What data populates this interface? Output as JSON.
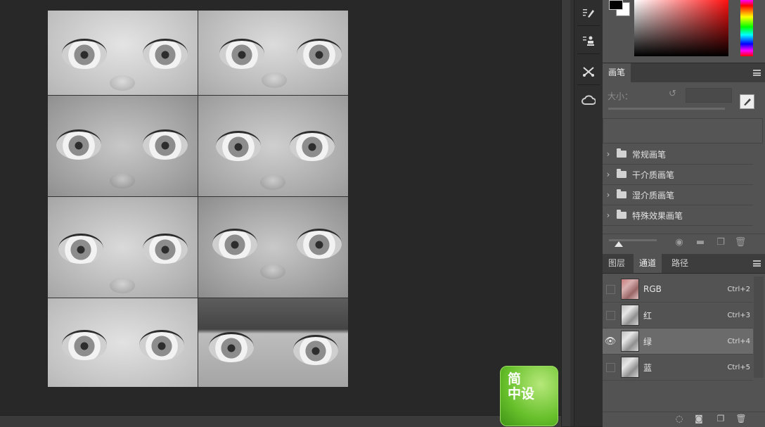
{
  "toolstrip": {
    "items": [
      {
        "icon": "brush-preset-icon"
      },
      {
        "icon": "clone-source-icon"
      },
      {
        "icon": "tool-presets-icon"
      },
      {
        "icon": "creative-cloud-icon"
      }
    ]
  },
  "color_panel": {
    "foreground": "#000000",
    "background": "#ffffff",
    "picker_hue": "#ff0000"
  },
  "brush_panel": {
    "tab": "画笔",
    "size_label": "大小：",
    "size_value": "",
    "folders": [
      "常规画笔",
      "干介质画笔",
      "湿介质画笔",
      "特殊效果画笔"
    ]
  },
  "channels_panel": {
    "tabs": [
      "图层",
      "通道",
      "路径"
    ],
    "active_tab": "通道",
    "channels": [
      {
        "name": "RGB",
        "shortcut": "Ctrl+2",
        "visible": false,
        "selected": false
      },
      {
        "name": "红",
        "shortcut": "Ctrl+3",
        "visible": false,
        "selected": false
      },
      {
        "name": "绿",
        "shortcut": "Ctrl+4",
        "visible": true,
        "selected": true
      },
      {
        "name": "蓝",
        "shortcut": "Ctrl+5",
        "visible": false,
        "selected": false
      }
    ]
  },
  "watermark": {
    "text": "简中设"
  }
}
